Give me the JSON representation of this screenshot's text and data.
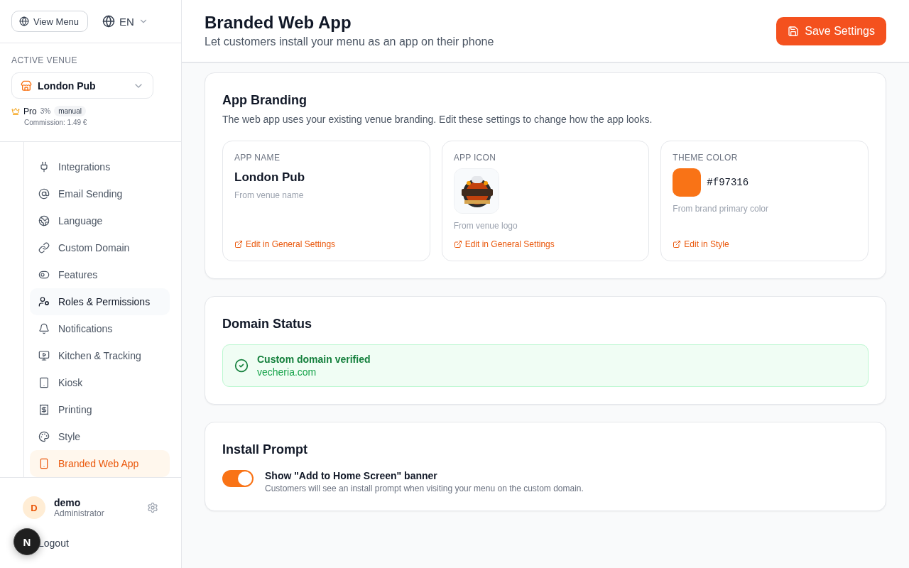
{
  "sidebar": {
    "view_menu": "View Menu",
    "language": "EN",
    "venue": {
      "label": "ACTIVE VENUE",
      "selected": "London Pub",
      "plan": "Pro",
      "rate": "3%",
      "badge": "manual",
      "commission": "Commission: 1.49 €"
    },
    "items": [
      {
        "label": "Integrations",
        "selected": false
      },
      {
        "label": "Email Sending",
        "selected": false
      },
      {
        "label": "Language",
        "selected": false
      },
      {
        "label": "Custom Domain",
        "selected": false
      },
      {
        "label": "Features",
        "selected": false
      },
      {
        "label": "Roles & Permissions",
        "selected": false,
        "hovered": true
      },
      {
        "label": "Notifications",
        "selected": false
      },
      {
        "label": "Kitchen & Tracking",
        "selected": false
      },
      {
        "label": "Kiosk",
        "selected": false
      },
      {
        "label": "Printing",
        "selected": false
      },
      {
        "label": "Style",
        "selected": false
      },
      {
        "label": "Branded Web App",
        "selected": true
      }
    ],
    "user": {
      "initial": "D",
      "name": "demo",
      "role": "Administrator",
      "logout": "Logout"
    },
    "dev_badge": "N"
  },
  "header": {
    "title": "Branded Web App",
    "subtitle": "Let customers install your menu as an app on their phone",
    "save": "Save Settings"
  },
  "branding": {
    "title": "App Branding",
    "description": "The web app uses your existing venue branding. Edit these settings to change how the app looks.",
    "fields": [
      {
        "kind": "text",
        "label": "APP NAME",
        "value": "London Pub",
        "hint": "From venue name",
        "link": "Edit in General Settings"
      },
      {
        "label": "APP ICON",
        "hint": "From venue logo",
        "link": "Edit in General Settings"
      },
      {
        "kind": "color",
        "label": "THEME COLOR",
        "color": "#f97316",
        "value": "#f97316",
        "hint": "From brand primary color",
        "link": "Edit in Style"
      }
    ]
  },
  "domain": {
    "title": "Domain Status",
    "verified": true,
    "status": "Custom domain verified",
    "domain": "vecheria.com"
  },
  "install": {
    "title": "Install Prompt",
    "on": true,
    "label": "Show \"Add to Home Screen\" banner",
    "description": "Customers will see an install prompt when visiting your menu on the custom domain."
  }
}
